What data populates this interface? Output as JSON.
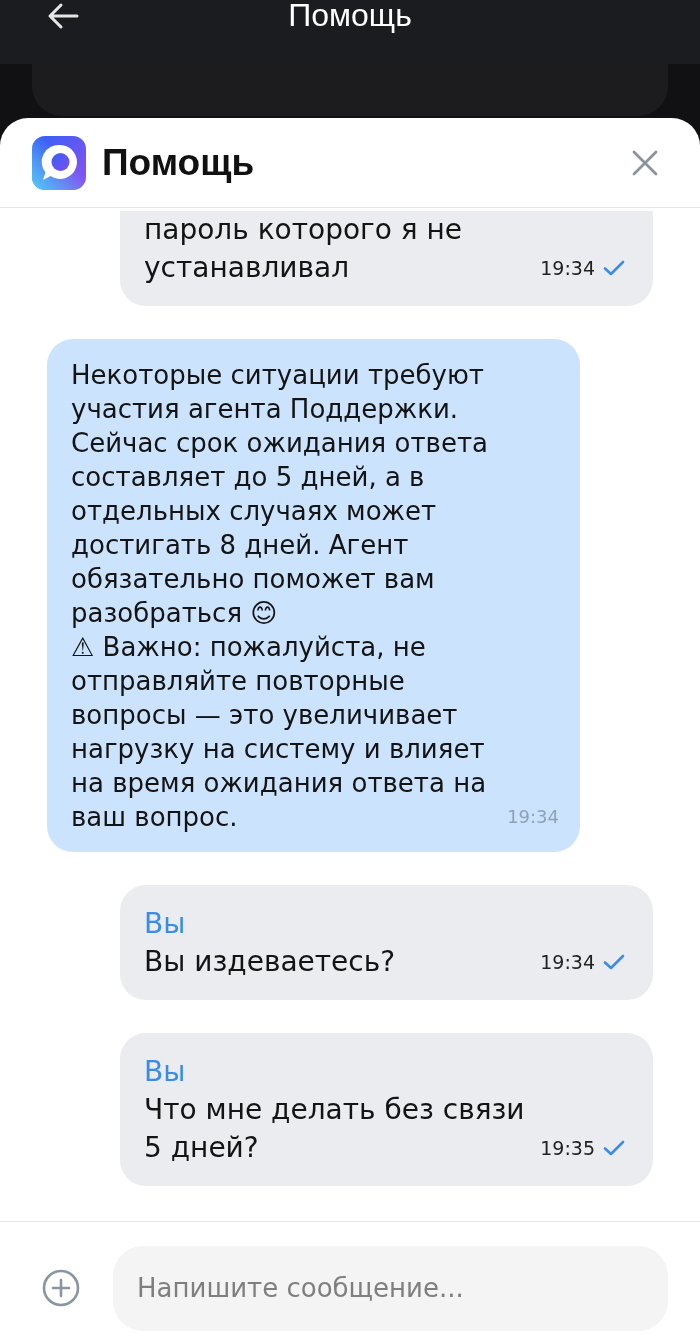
{
  "top_bar": {
    "title": "Помощь"
  },
  "sheet": {
    "title": "Помощь"
  },
  "messages": [
    {
      "kind": "outgoing",
      "clipped_top": true,
      "text": "пароль которого я не устанавливал",
      "time": "19:34",
      "delivered": true
    },
    {
      "kind": "incoming",
      "text": "Некоторые ситуации требуют участия агента Поддержки. Сейчас срок ожидания ответа составляет до 5 дней, а в отдельных случаях может достигать 8 дней. Агент обязательно поможет вам разобраться 😊\n⚠ Важно: пожалуйста, не отправляйте повторные вопросы — это увеличивает нагрузку на систему и влияет на время ожидания ответа на ваш вопрос.",
      "time": "19:34"
    },
    {
      "kind": "outgoing",
      "clipped_top": false,
      "sender": "Вы",
      "text": "Вы издеваетесь?",
      "time": "19:34",
      "delivered": true
    },
    {
      "kind": "outgoing",
      "clipped_top": false,
      "sender": "Вы",
      "text": "Что мне делать без связи 5 дней?",
      "time": "19:35",
      "delivered": true
    }
  ],
  "composer": {
    "placeholder": "Напишите сообщение..."
  }
}
